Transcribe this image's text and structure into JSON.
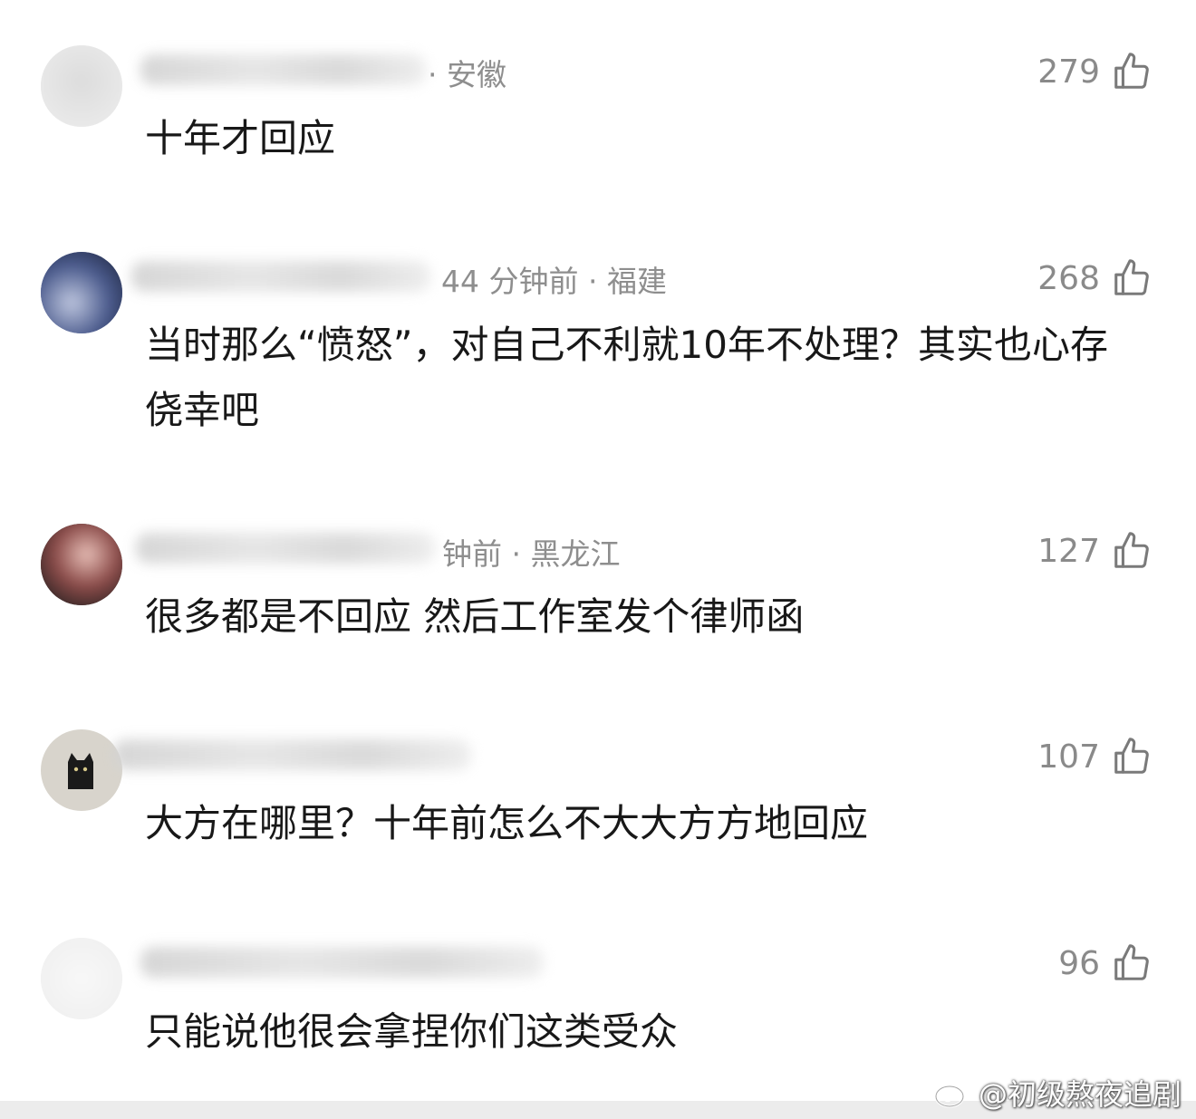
{
  "comments": [
    {
      "meta": "· 安徽",
      "likes": "279",
      "text": "十年才回应"
    },
    {
      "meta": "44 分钟前 · 福建",
      "likes": "268",
      "text": "当时那么“愤怒”，对自己不利就10年不处理？其实也心存侥幸吧"
    },
    {
      "meta": "钟前 · 黑龙江",
      "likes": "127",
      "text": "很多都是不回应 然后工作室发个律师函"
    },
    {
      "meta": "",
      "likes": "107",
      "text": "大方在哪里？十年前怎么不大大方方地回应"
    },
    {
      "meta": "",
      "likes": "96",
      "text": "只能说他很会拿捏你们这类受众"
    }
  ],
  "watermark": {
    "text": "@初级熬夜追剧",
    "icon": "weibo-logo-icon"
  },
  "icons": {
    "like": "thumbs-up-icon"
  }
}
